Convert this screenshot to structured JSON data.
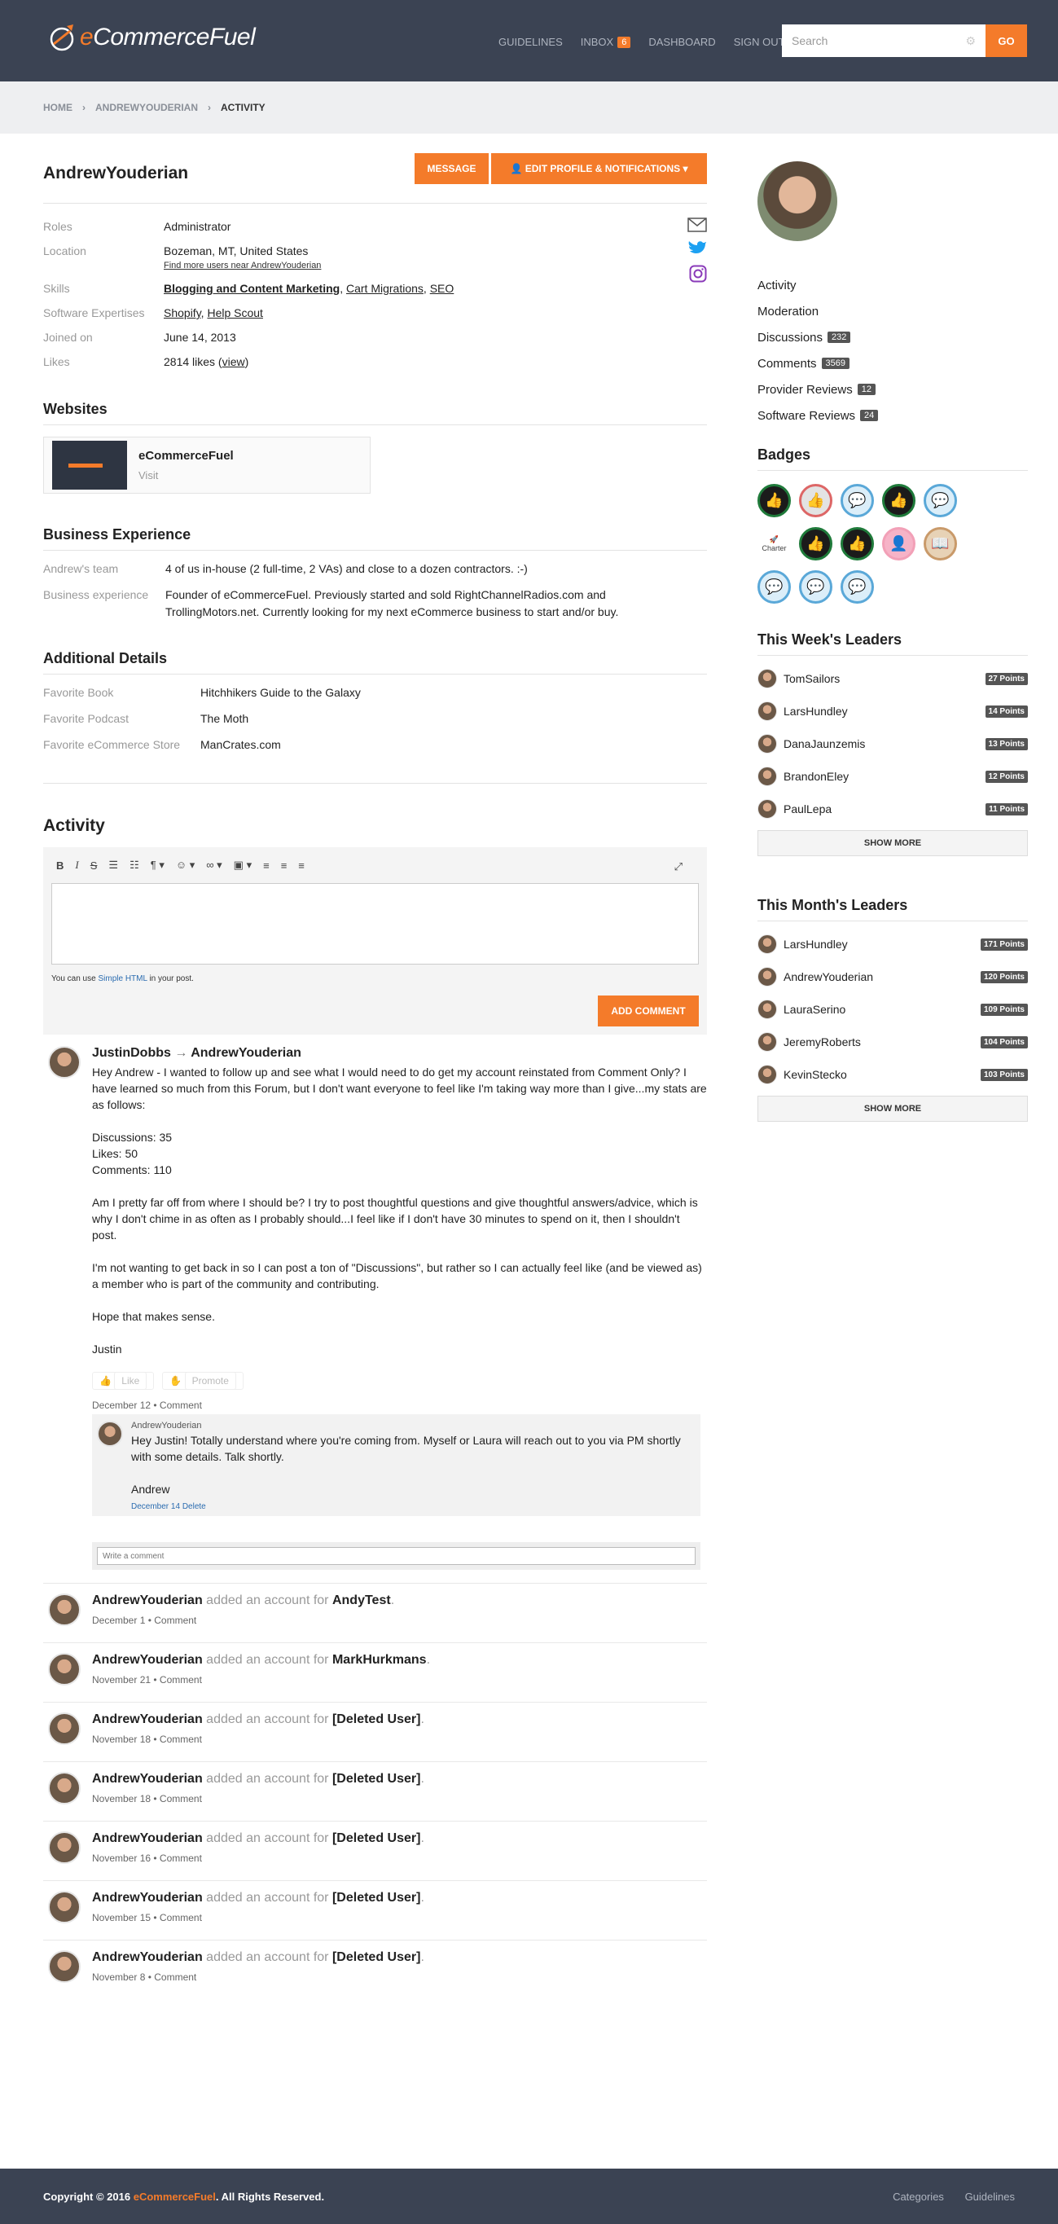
{
  "header": {
    "logo_prefix": "e",
    "logo_text": "CommerceFuel",
    "nav": [
      "GUIDELINES",
      "INBOX",
      "DASHBOARD",
      "SIGN OUT"
    ],
    "inbox_count": "6",
    "search_placeholder": "Search",
    "search_button": "GO"
  },
  "breadcrumb": [
    "HOME",
    "ANDREWYOUDERIAN",
    "ACTIVITY"
  ],
  "profile": {
    "username": "AndrewYouderian",
    "message_button": "MESSAGE",
    "edit_button": "EDIT PROFILE & NOTIFICATIONS",
    "roles_label": "Roles",
    "roles": "Administrator",
    "location_label": "Location",
    "location": "Bozeman, MT, United States",
    "location_sub": "Find more users near AndrewYouderian",
    "skills_label": "Skills",
    "skill_1": "Blogging and Content Marketing",
    "skill_2": "Cart Migrations",
    "skill_3": "SEO",
    "software_label": "Software Expertises",
    "software_1": "Shopify",
    "software_2": "Help Scout",
    "joined_label": "Joined on",
    "joined": "June 14, 2013",
    "likes_label": "Likes",
    "likes": "2814 likes",
    "likes_view": "view"
  },
  "websites": {
    "title": "Websites",
    "name": "eCommerceFuel",
    "visit": "Visit"
  },
  "business": {
    "title": "Business Experience",
    "team_label": "Andrew's team",
    "team": "4 of us in-house (2 full-time, 2 VAs) and close to a dozen contractors. :-)",
    "exp_label": "Business experience",
    "exp": "Founder of eCommerceFuel. Previously started and sold RightChannelRadios.com and TrollingMotors.net. Currently looking for my next eCommerce business to start and/or buy."
  },
  "additional": {
    "title": "Additional Details",
    "book_label": "Favorite Book",
    "book": "Hitchhikers Guide to the Galaxy",
    "podcast_label": "Favorite Podcast",
    "podcast": "The Moth",
    "store_label": "Favorite eCommerce Store",
    "store": "ManCrates.com"
  },
  "activity": {
    "title": "Activity",
    "help_prefix": "You can use",
    "help_link": "Simple HTML",
    "help_suffix": "in your post.",
    "add_comment": "ADD COMMENT",
    "post": {
      "author": "JustinDobbs",
      "arrow": "→",
      "target": "AndrewYouderian",
      "p1": "Hey Andrew - I wanted to follow up and see what I would need to do get my account reinstated from Comment Only? I have learned so much from this Forum, but I don't want everyone to feel like I'm taking way more than I give...my stats are as follows:",
      "stat1": "Discussions: 35",
      "stat2": "Likes: 50",
      "stat3": "Comments: 110",
      "p3": "Am I pretty far off from where I should be? I try to post thoughtful questions and give thoughtful answers/advice, which is why I don't chime in as often as I probably should...I feel like if I don't have 30 minutes to spend on it, then I shouldn't post.",
      "p4": "I'm not wanting to get back in so I can post a ton of \"Discussions\", but rather so I can actually feel like (and be viewed as) a member who is part of the community and contributing.",
      "p5": "Hope that makes sense.",
      "p6": "Justin",
      "like": "Like",
      "promote": "Promote",
      "date": "December 12",
      "comment": "Comment",
      "reply_author": "AndrewYouderian",
      "reply_body": "Hey Justin! Totally understand where you're coming from. Myself or Laura will reach out to you via PM shortly with some details. Talk shortly.",
      "reply_sign": "Andrew",
      "reply_date": "December 14",
      "reply_delete": "Delete",
      "write_placeholder": "Write a comment"
    },
    "feed_verb": "added an account for",
    "feed": [
      {
        "who": "AndrewYouderian",
        "target": "AndyTest",
        "date": "December 1"
      },
      {
        "who": "AndrewYouderian",
        "target": "MarkHurkmans",
        "date": "November 21"
      },
      {
        "who": "AndrewYouderian",
        "target": "[Deleted User]",
        "date": "November 18"
      },
      {
        "who": "AndrewYouderian",
        "target": "[Deleted User]",
        "date": "November 18"
      },
      {
        "who": "AndrewYouderian",
        "target": "[Deleted User]",
        "date": "November 16"
      },
      {
        "who": "AndrewYouderian",
        "target": "[Deleted User]",
        "date": "November 15"
      },
      {
        "who": "AndrewYouderian",
        "target": "[Deleted User]",
        "date": "November 8"
      }
    ]
  },
  "sidebar": {
    "links": [
      {
        "label": "Activity",
        "count": ""
      },
      {
        "label": "Moderation",
        "count": ""
      },
      {
        "label": "Discussions",
        "count": "232"
      },
      {
        "label": "Comments",
        "count": "3569"
      },
      {
        "label": "Provider Reviews",
        "count": "12"
      },
      {
        "label": "Software Reviews",
        "count": "24"
      }
    ],
    "badges_title": "Badges",
    "charter_label": "Charter",
    "week_title": "This Week's Leaders",
    "week": [
      {
        "name": "TomSailors",
        "points": "27 Points"
      },
      {
        "name": "LarsHundley",
        "points": "14 Points"
      },
      {
        "name": "DanaJaunzemis",
        "points": "13 Points"
      },
      {
        "name": "BrandonEley",
        "points": "12 Points"
      },
      {
        "name": "PaulLepa",
        "points": "11 Points"
      }
    ],
    "month_title": "This Month's Leaders",
    "month": [
      {
        "name": "LarsHundley",
        "points": "171 Points"
      },
      {
        "name": "AndrewYouderian",
        "points": "120 Points"
      },
      {
        "name": "LauraSerino",
        "points": "109 Points"
      },
      {
        "name": "JeremyRoberts",
        "points": "104 Points"
      },
      {
        "name": "KevinStecko",
        "points": "103 Points"
      }
    ],
    "show_more": "SHOW MORE"
  },
  "footer": {
    "copy_prefix": "Copyright © 2016",
    "copy_brand": "eCommerceFuel",
    "copy_suffix": ". All Rights Reserved.",
    "links": [
      "Categories",
      "Guidelines"
    ]
  },
  "colors": {
    "accent": "#f47b2a",
    "header": "#3b4353"
  }
}
